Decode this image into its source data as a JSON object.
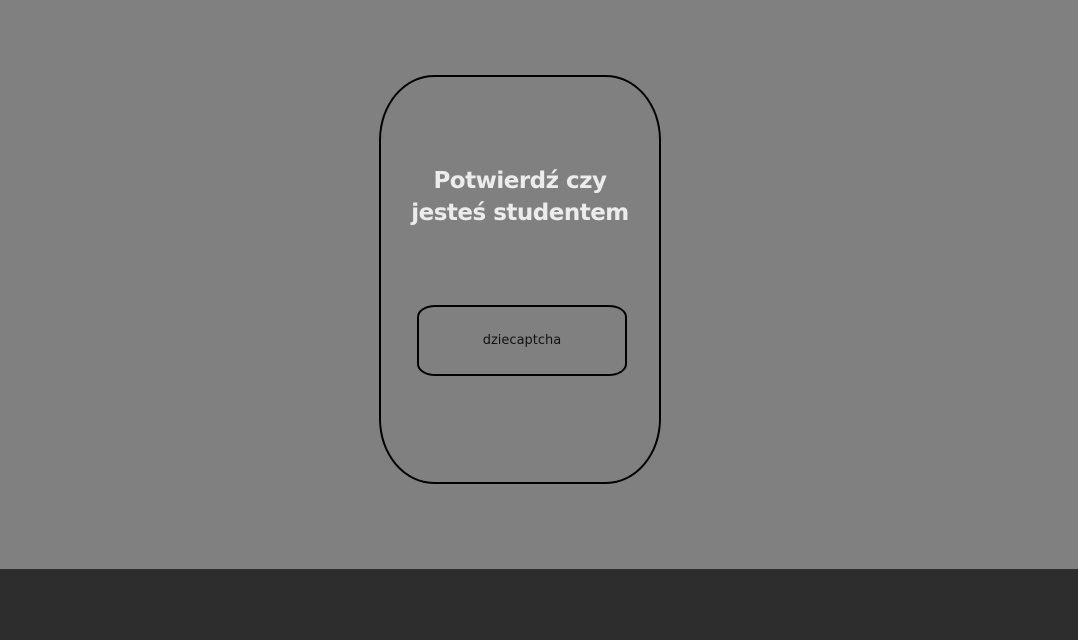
{
  "card": {
    "title_line1": "Potwierdź czy",
    "title_line2": "jesteś studentem",
    "button_label": "dziecaptcha"
  },
  "colors": {
    "background": "#808080",
    "bottom_bar": "#2d2d2d",
    "title_text": "#ececec",
    "border": "#000000"
  }
}
